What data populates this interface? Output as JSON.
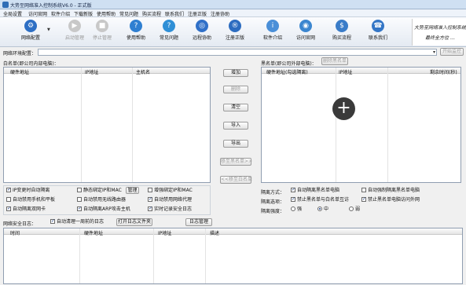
{
  "window": {
    "title": "大势至网络准入控制系统V6.0 - 正式版"
  },
  "menu": [
    "全局设置",
    "访问官网",
    "软件介绍",
    "下载新版",
    "使用帮助",
    "常见问题",
    "购买流程",
    "联系我们",
    "注册正版",
    "注册协助"
  ],
  "toolbar": {
    "buttons": [
      {
        "label": "网络配置",
        "icon": "gear-icon",
        "color": "#2e6fc4",
        "enabled": true
      },
      {
        "label": "启动管理",
        "icon": "play-icon",
        "color": "#c8c8c8",
        "enabled": false
      },
      {
        "label": "停止管理",
        "icon": "stop-icon",
        "color": "#c8c8c8",
        "enabled": false
      },
      {
        "label": "使用帮助",
        "icon": "help-icon",
        "color": "#2f7fd1",
        "enabled": true
      },
      {
        "label": "常见问题",
        "icon": "question-icon",
        "color": "#2f8fd6",
        "enabled": true
      },
      {
        "label": "远程协助",
        "icon": "remote-icon",
        "color": "#3070c8",
        "enabled": true
      },
      {
        "label": "注册正版",
        "icon": "register-icon",
        "color": "#2c6cc0",
        "enabled": true
      },
      {
        "label": "软件介绍",
        "icon": "info-icon",
        "color": "#4a8fd8",
        "enabled": true
      },
      {
        "label": "访问官网",
        "icon": "globe-icon",
        "color": "#3b86d0",
        "enabled": true
      },
      {
        "label": "购买流程",
        "icon": "cart-icon",
        "color": "#3a7cc8",
        "enabled": true
      },
      {
        "label": "联系我们",
        "icon": "contact-icon",
        "color": "#3476c6",
        "enabled": true
      }
    ],
    "dropdown_glyph": "▼",
    "banner_lines": [
      "大势至网络准入控制系统",
      "最终全方位 …"
    ]
  },
  "net_config": {
    "label": "网络环境配置：",
    "value": "",
    "start_button": "开始监控"
  },
  "whitelist": {
    "title": "白名单(即公司内部电脑)：",
    "columns": [
      "硬件地址",
      "IP地址",
      "主机名"
    ]
  },
  "middle_buttons": [
    "增加",
    "删除",
    "清空",
    "导入",
    "导出",
    "移至黑名单>>",
    "<<移至白名单"
  ],
  "blacklist": {
    "title": "黑名单(即公司外部电脑)：",
    "clear_button": "删除黑名单",
    "columns": [
      "硬件地址(勾选隔离)",
      "IP地址",
      "剩余时间(秒)"
    ]
  },
  "left_options": [
    {
      "label": "IP变更时自动隔离",
      "checked": true
    },
    {
      "label": "静态绑定IP和MAC",
      "checked": false
    },
    {
      "label": "管理",
      "type": "button"
    },
    {
      "label": "增强绑定IP和MAC",
      "checked": false
    },
    {
      "label": "自动禁用手机和平板",
      "checked": false
    },
    {
      "label": "自动禁用无线路由器",
      "checked": false
    },
    {
      "label": "自动禁用网络代理",
      "checked": true
    },
    {
      "label": "自动隔离双网卡",
      "checked": true
    },
    {
      "label": "自动隔离ARP攻击主机",
      "checked": true
    },
    {
      "label": "实时记录安全日志",
      "checked": true
    }
  ],
  "right_options": {
    "isolation_mode_label": "隔离方式：",
    "isolation_mode": [
      {
        "label": "自动隔离黑名单电脑",
        "checked": true
      },
      {
        "label": "自动强制隔离黑名单电脑",
        "checked": false
      }
    ],
    "isolation_option_label": "隔离选项：",
    "isolation_options": [
      {
        "label": "禁止黑名单与白名单互访",
        "checked": true
      },
      {
        "label": "禁止黑名单电脑访问外网",
        "checked": true
      }
    ],
    "strength_label": "隔离强度：",
    "strength": [
      {
        "label": "强",
        "selected": false
      },
      {
        "label": "中",
        "selected": true
      },
      {
        "label": "弱",
        "selected": false
      }
    ]
  },
  "log": {
    "label": "网络安全日志：",
    "auto_clear": {
      "label": "自动清理一周前的日志",
      "checked": true
    },
    "open_folder_button": "打开日志文件夹",
    "manage_button": "日志管理",
    "columns": [
      "时间",
      "硬件地址",
      "IP地址",
      "描述"
    ]
  },
  "overlay_icon": "+"
}
